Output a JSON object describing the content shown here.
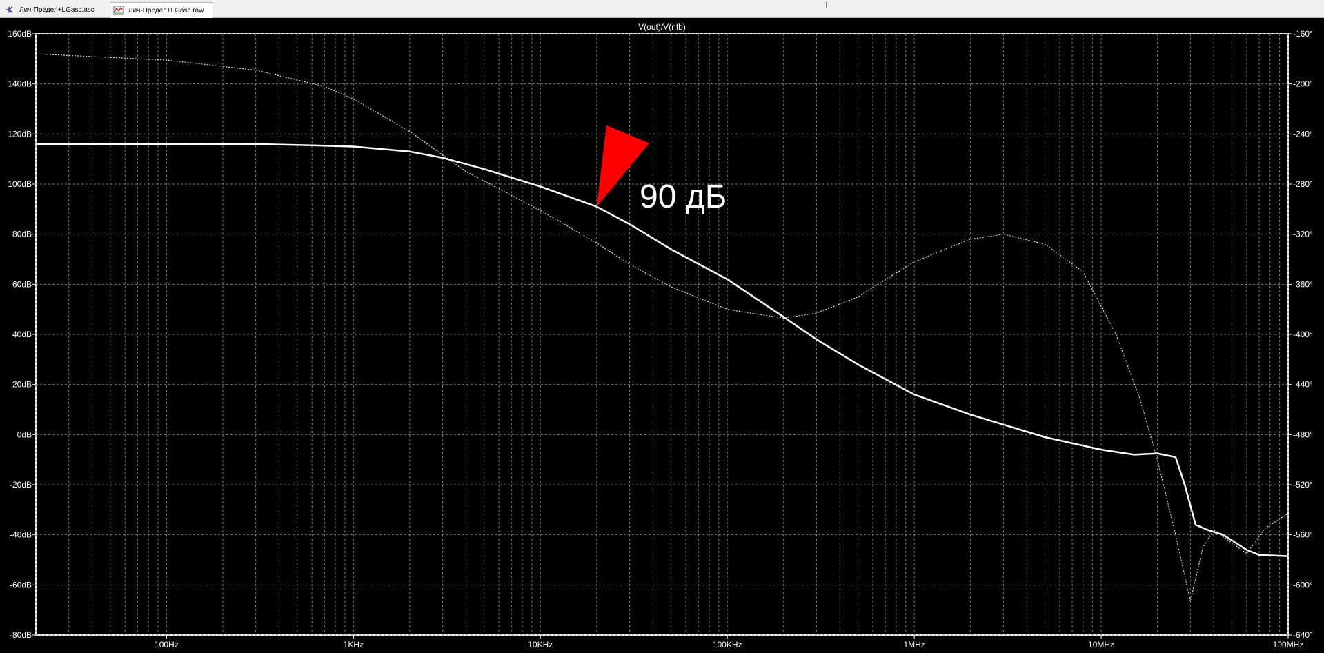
{
  "tabs": [
    {
      "label": "Лич-Предел+LGasc.asc",
      "icon": "schematic-icon"
    },
    {
      "label": "Лич-Предел+LGasc.raw",
      "icon": "waveform-icon"
    }
  ],
  "annotation": {
    "text": "90 дБ",
    "color": "#ff0000"
  },
  "chart_data": {
    "type": "line",
    "title": "V(out)/V(nfb)",
    "x_scale": "log",
    "xlim": [
      20,
      100000000
    ],
    "ylim_left": [
      -80,
      160
    ],
    "ylim_right": [
      -640,
      -160
    ],
    "x_ticks": [
      {
        "v": 100,
        "label": "100Hz"
      },
      {
        "v": 1000,
        "label": "1KHz"
      },
      {
        "v": 10000,
        "label": "10KHz"
      },
      {
        "v": 100000,
        "label": "100KHz"
      },
      {
        "v": 1000000,
        "label": "1MHz"
      },
      {
        "v": 10000000,
        "label": "10MHz"
      },
      {
        "v": 100000000,
        "label": "100MHz"
      }
    ],
    "y_ticks_left": [
      {
        "v": 160,
        "label": "160dB"
      },
      {
        "v": 140,
        "label": "140dB"
      },
      {
        "v": 120,
        "label": "120dB"
      },
      {
        "v": 100,
        "label": "100dB"
      },
      {
        "v": 80,
        "label": "80dB"
      },
      {
        "v": 60,
        "label": "60dB"
      },
      {
        "v": 40,
        "label": "40dB"
      },
      {
        "v": 20,
        "label": "20dB"
      },
      {
        "v": 0,
        "label": "0dB"
      },
      {
        "v": -20,
        "label": "-20dB"
      },
      {
        "v": -40,
        "label": "-40dB"
      },
      {
        "v": -60,
        "label": "-60dB"
      },
      {
        "v": -80,
        "label": "-80dB"
      }
    ],
    "y_ticks_right": [
      {
        "v": -160,
        "label": "-160°"
      },
      {
        "v": -200,
        "label": "-200°"
      },
      {
        "v": -240,
        "label": "-240°"
      },
      {
        "v": -280,
        "label": "-280°"
      },
      {
        "v": -320,
        "label": "-320°"
      },
      {
        "v": -360,
        "label": "-360°"
      },
      {
        "v": -400,
        "label": "-400°"
      },
      {
        "v": -440,
        "label": "-440°"
      },
      {
        "v": -480,
        "label": "-480°"
      },
      {
        "v": -520,
        "label": "-520°"
      },
      {
        "v": -560,
        "label": "-560°"
      },
      {
        "v": -600,
        "label": "-600°"
      },
      {
        "v": -640,
        "label": "-640°"
      }
    ],
    "series": [
      {
        "axis": "left",
        "style": "solid",
        "color": "#ffffff",
        "points": [
          [
            20,
            116
          ],
          [
            100,
            116
          ],
          [
            300,
            116
          ],
          [
            600,
            115.5
          ],
          [
            1000,
            115
          ],
          [
            2000,
            113
          ],
          [
            3000,
            110.5
          ],
          [
            5000,
            106
          ],
          [
            10000,
            99
          ],
          [
            20000,
            91
          ],
          [
            30000,
            84
          ],
          [
            50000,
            74
          ],
          [
            100000,
            62
          ],
          [
            200000,
            47
          ],
          [
            300000,
            38
          ],
          [
            500000,
            28
          ],
          [
            1000000,
            16
          ],
          [
            2000000,
            8
          ],
          [
            3000000,
            4
          ],
          [
            5000000,
            -1
          ],
          [
            10000000,
            -6
          ],
          [
            15000000,
            -8
          ],
          [
            20000000,
            -7.5
          ],
          [
            25000000,
            -9
          ],
          [
            28000000,
            -20
          ],
          [
            32000000,
            -36
          ],
          [
            37000000,
            -38
          ],
          [
            45000000,
            -40
          ],
          [
            60000000,
            -46
          ],
          [
            70000000,
            -48
          ],
          [
            100000000,
            -48.5
          ]
        ]
      },
      {
        "axis": "right",
        "style": "dashed",
        "color": "#ffffff",
        "points": [
          [
            20,
            -176
          ],
          [
            100,
            -181
          ],
          [
            300,
            -189
          ],
          [
            700,
            -202
          ],
          [
            1000,
            -212
          ],
          [
            2000,
            -238
          ],
          [
            4000,
            -270
          ],
          [
            10000,
            -301
          ],
          [
            20000,
            -327
          ],
          [
            30000,
            -344
          ],
          [
            50000,
            -362
          ],
          [
            100000,
            -380
          ],
          [
            200000,
            -387
          ],
          [
            300000,
            -383
          ],
          [
            500000,
            -370
          ],
          [
            1000000,
            -342
          ],
          [
            2000000,
            -324
          ],
          [
            3000000,
            -320
          ],
          [
            5000000,
            -328
          ],
          [
            8000000,
            -350
          ],
          [
            12000000,
            -400
          ],
          [
            16000000,
            -450
          ],
          [
            20000000,
            -500
          ],
          [
            25000000,
            -560
          ],
          [
            30000000,
            -613
          ],
          [
            35000000,
            -570
          ],
          [
            40000000,
            -556
          ],
          [
            60000000,
            -575
          ],
          [
            75000000,
            -555
          ],
          [
            100000000,
            -543
          ]
        ]
      }
    ]
  }
}
